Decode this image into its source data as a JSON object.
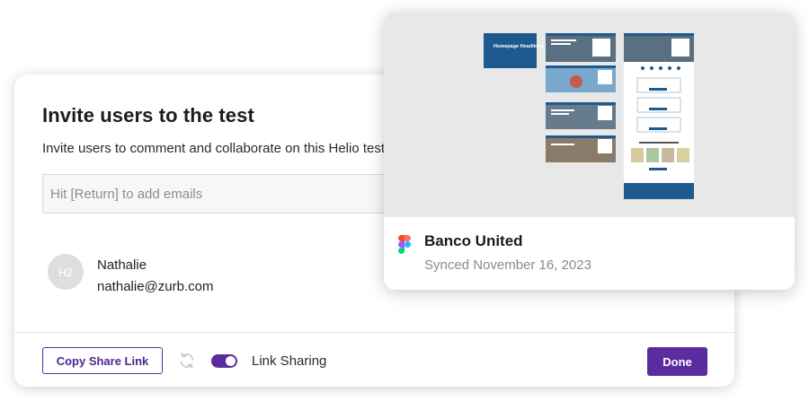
{
  "invite_modal": {
    "title": "Invite users to the test",
    "description": "Invite users to comment and collaborate on this Helio test",
    "email_input": {
      "value": "",
      "placeholder": "Hit [Return] to add emails"
    },
    "users": [
      {
        "avatar_initials": "H2",
        "name": "Nathalie",
        "email": "nathalie@zurb.com"
      }
    ],
    "footer": {
      "copy_link_label": "Copy Share Link",
      "sync_icon": "refresh-icon",
      "link_sharing_toggle": {
        "on": true
      },
      "link_sharing_label": "Link Sharing",
      "done_label": "Done"
    }
  },
  "file_card": {
    "thumbnail_label": "Homepage Headlines",
    "title": "Banco United",
    "synced_text": "Synced November 16, 2023",
    "icon": "figma-logo-icon"
  },
  "colors": {
    "accent": "#5a2ca0",
    "thumb_blue": "#1f5a8f",
    "thumb_bg": "#e8e8e8"
  }
}
